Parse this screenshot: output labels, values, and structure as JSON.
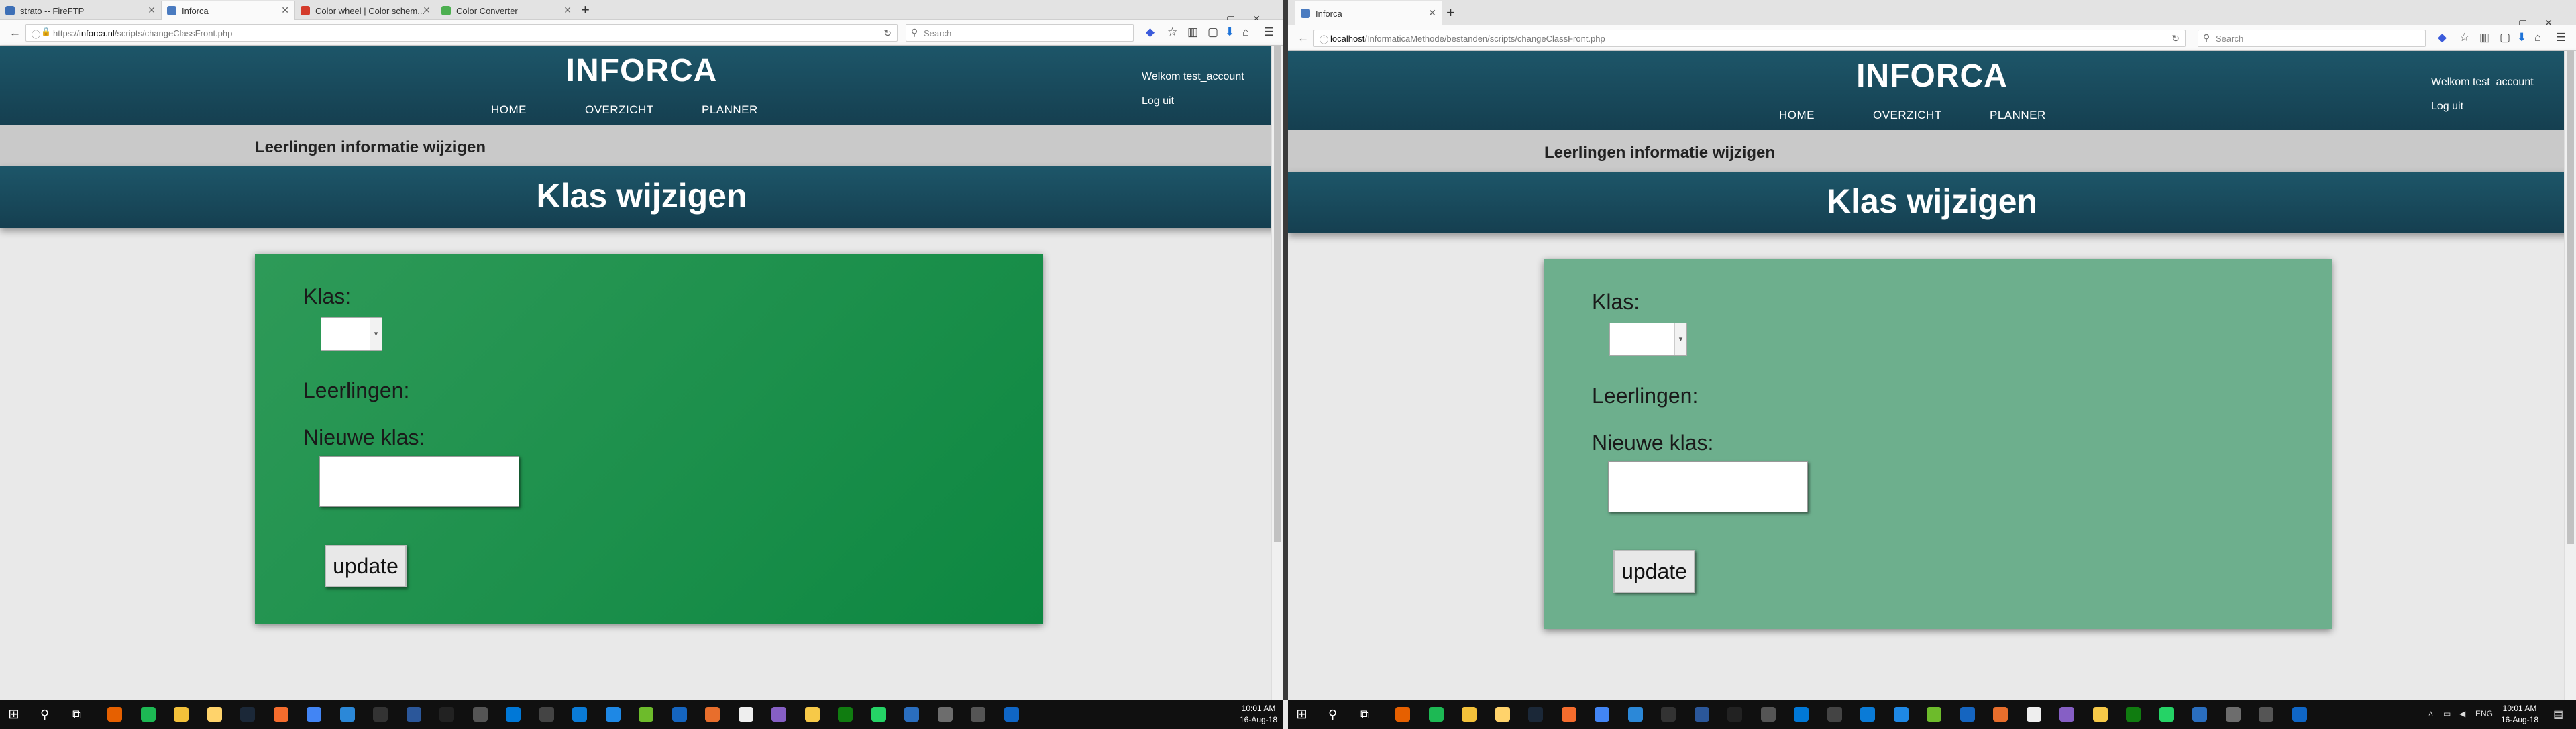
{
  "left": {
    "tabs": [
      {
        "title": "strato -- FireFTP",
        "color": "#3d6fb6"
      },
      {
        "title": "Inforca",
        "color": "#4a7bc0"
      },
      {
        "title": "Color wheel | Color schem...",
        "color": "#d43b2b"
      },
      {
        "title": "Color Converter",
        "color": "#4caf50"
      }
    ],
    "url_prefix": "https://",
    "url_host": "inforca.nl",
    "url_path": "/scripts/changeClassFront.php",
    "card_color": "#0f8a46",
    "clock_time": "10:01 AM",
    "clock_date": "16-Aug-18"
  },
  "right": {
    "tabs": [
      {
        "title": "Inforca",
        "color": "#4a7bc0"
      }
    ],
    "url_prefix": "",
    "url_host": "localhost",
    "url_path": "/InformaticaMethode/bestanden/scripts/changeClassFront.php",
    "card_color": "#6daf8d",
    "clock_time": "10:01 AM",
    "clock_date": "16-Aug-18",
    "tray_lang": "ENG"
  },
  "search_placeholder": "Search",
  "site": {
    "logo": "INFORCA",
    "menu": [
      "HOME",
      "OVERZICHT",
      "PLANNER"
    ],
    "welcome": "Welkom test_account",
    "logout": "Log uit",
    "subtitle": "Leerlingen informatie wijzigen",
    "page_title": "Klas wijzigen",
    "form": {
      "klas_label": "Klas:",
      "leerlingen_label": "Leerlingen:",
      "nieuwe_klas_label": "Nieuwe klas:",
      "nieuwe_klas_value": "",
      "update_label": "update"
    },
    "header_color": "#1d5669"
  },
  "taskbar_icons": [
    {
      "name": "firefox-icon",
      "color": "#e66000"
    },
    {
      "name": "spotify-icon",
      "color": "#1db954"
    },
    {
      "name": "file-explorer-icon",
      "color": "#f3c13a"
    },
    {
      "name": "folder-icon",
      "color": "#ffd36b"
    },
    {
      "name": "steam-icon",
      "color": "#1b2838"
    },
    {
      "name": "origin-icon",
      "color": "#f56c2d"
    },
    {
      "name": "chrome-icon",
      "color": "#4285f4"
    },
    {
      "name": "app-icon",
      "color": "#2b88d8"
    },
    {
      "name": "terminal-icon",
      "color": "#333"
    },
    {
      "name": "word-icon",
      "color": "#2b579a"
    },
    {
      "name": "unity-icon",
      "color": "#222"
    },
    {
      "name": "calculator-icon",
      "color": "#555"
    },
    {
      "name": "vs-code-icon",
      "color": "#0078d7"
    },
    {
      "name": "unreal-icon",
      "color": "#444"
    },
    {
      "name": "edge-icon",
      "color": "#0a7bd7"
    },
    {
      "name": "store-icon",
      "color": "#1e88e5"
    },
    {
      "name": "greenapp-icon",
      "color": "#6dbb2b"
    },
    {
      "name": "blueapp-icon",
      "color": "#1565c0"
    },
    {
      "name": "orangeapp-icon",
      "color": "#e86e2c"
    },
    {
      "name": "uplay-icon",
      "color": "#eee"
    },
    {
      "name": "visual-studio-icon",
      "color": "#865fc5"
    },
    {
      "name": "paint-icon",
      "color": "#f7c948"
    },
    {
      "name": "xbox-icon",
      "color": "#107c10"
    },
    {
      "name": "whatsapp-icon",
      "color": "#25d366"
    },
    {
      "name": "mail-icon",
      "color": "#2a6ebf"
    },
    {
      "name": "photos-icon",
      "color": "#6d6d6d"
    },
    {
      "name": "settings-icon",
      "color": "#555"
    },
    {
      "name": "onedrive-icon",
      "color": "#0f66c6"
    }
  ]
}
